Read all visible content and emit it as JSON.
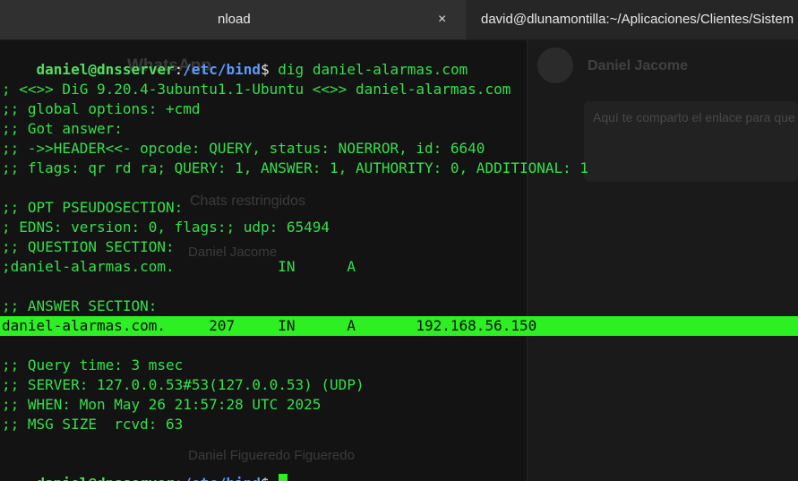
{
  "tabs": [
    {
      "title": "nload",
      "close_icon": "×"
    },
    {
      "title": "david@dlunamontilla:~/Aplicaciones/Clientes/Sistem"
    }
  ],
  "prompt": {
    "user_host": "daniel@dnsserver",
    "sep": ":",
    "path": "/etc/bind",
    "symbol": "$"
  },
  "command": "dig daniel-alarmas.com",
  "output": {
    "header": "; <<>> DiG 9.20.4-3ubuntu1.1-Ubuntu <<>> daniel-alarmas.com",
    "global_options": ";; global options: +cmd",
    "got_answer": ";; Got answer:",
    "header_line": ";; ->>HEADER<<- opcode: QUERY, status: NOERROR, id: 6640",
    "flags_line": ";; flags: qr rd ra; QUERY: 1, ANSWER: 1, AUTHORITY: 0, ADDITIONAL: 1",
    "opt_section": ";; OPT PSEUDOSECTION:",
    "edns": "; EDNS: version: 0, flags:; udp: 65494",
    "question_section": ";; QUESTION SECTION:",
    "question": ";daniel-alarmas.com.            IN      A",
    "answer_section": ";; ANSWER SECTION:",
    "answer": "daniel-alarmas.com.     207     IN      A       192.168.56.150",
    "query_time": ";; Query time: 3 msec",
    "server": ";; SERVER: 127.0.0.53#53(127.0.0.53) (UDP)",
    "when": ";; WHEN: Mon May 26 21:57:28 UTC 2025",
    "msg_size": ";; MSG SIZE  rcvd: 63"
  },
  "background_window": {
    "app_name": "WhatsApp",
    "contact_name": "Daniel Jacome",
    "chats_restricted": "Chats restringidos",
    "message_preview": "Aquí te comparto el enlace para que",
    "other_contact": "Daniel Figueredo Figueredo"
  }
}
